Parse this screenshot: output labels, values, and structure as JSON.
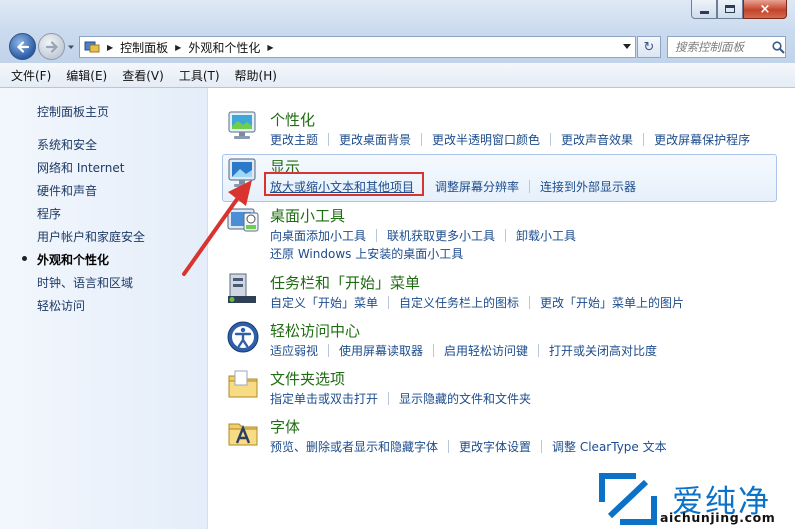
{
  "window": {
    "minimize_label": "minimize",
    "maximize_label": "maximize",
    "close_label": "×"
  },
  "address": {
    "crumbs": [
      "控制面板",
      "外观和个性化"
    ],
    "search_placeholder": "搜索控制面板"
  },
  "menu": [
    "文件(F)",
    "编辑(E)",
    "查看(V)",
    "工具(T)",
    "帮助(H)"
  ],
  "sidebar": {
    "home": "控制面板主页",
    "items": [
      "系统和安全",
      "网络和 Internet",
      "硬件和声音",
      "程序",
      "用户帐户和家庭安全",
      "外观和个性化",
      "时钟、语言和区域",
      "轻松访问"
    ],
    "current_index": 5
  },
  "categories": [
    {
      "title": "个性化",
      "icon": "monitor-personalize-icon",
      "links": [
        "更改主题",
        "更改桌面背景",
        "更改半透明窗口颜色",
        "更改声音效果",
        "更改屏幕保护程序"
      ],
      "links2": []
    },
    {
      "title": "显示",
      "icon": "display-monitor-icon",
      "links": [
        "放大或缩小文本和其他项目",
        "调整屏幕分辨率",
        "连接到外部显示器"
      ],
      "links2": []
    },
    {
      "title": "桌面小工具",
      "icon": "gadgets-icon",
      "links": [
        "向桌面添加小工具",
        "联机获取更多小工具",
        "卸载小工具"
      ],
      "links2": [
        "还原 Windows 上安装的桌面小工具"
      ]
    },
    {
      "title": "任务栏和「开始」菜单",
      "icon": "taskbar-icon",
      "links": [
        "自定义「开始」菜单",
        "自定义任务栏上的图标",
        "更改「开始」菜单上的图片"
      ],
      "links2": []
    },
    {
      "title": "轻松访问中心",
      "icon": "ease-of-access-icon",
      "links": [
        "适应弱视",
        "使用屏幕读取器",
        "启用轻松访问键",
        "打开或关闭高对比度"
      ],
      "links2": []
    },
    {
      "title": "文件夹选项",
      "icon": "folder-options-icon",
      "links": [
        "指定单击或双击打开",
        "显示隐藏的文件和文件夹"
      ],
      "links2": []
    },
    {
      "title": "字体",
      "icon": "fonts-icon",
      "links": [
        "预览、删除或者显示和隐藏字体",
        "更改字体设置",
        "调整 ClearType 文本"
      ],
      "links2": []
    }
  ],
  "watermark": {
    "brand": "爱纯净",
    "url": "aichunjing.com",
    "brand_color": "#0b72c7"
  },
  "colors": {
    "title_green": "#1f6d12",
    "link_blue": "#1c4c8c",
    "annotation_red": "#d8332e"
  }
}
